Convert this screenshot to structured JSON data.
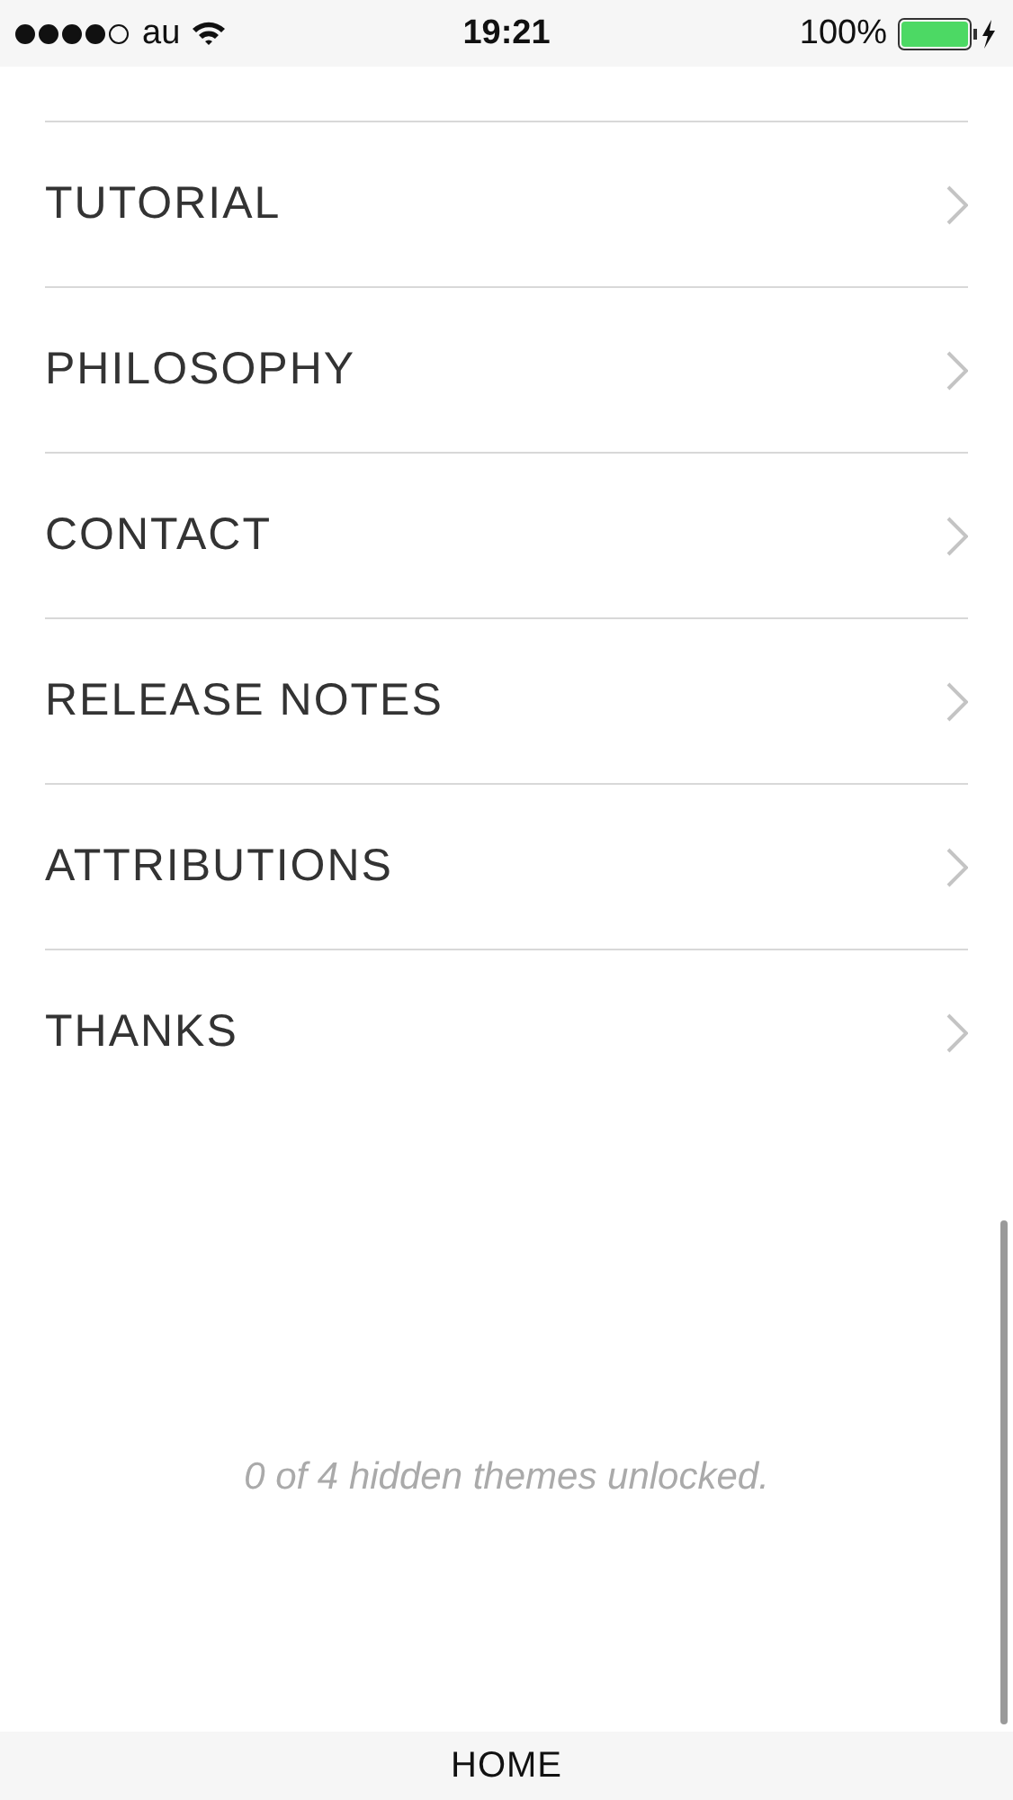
{
  "status_bar": {
    "carrier": "au",
    "time": "19:21",
    "battery": "100%"
  },
  "menu_items": [
    {
      "label": "TUTORIAL"
    },
    {
      "label": "PHILOSOPHY"
    },
    {
      "label": "CONTACT"
    },
    {
      "label": "RELEASE NOTES"
    },
    {
      "label": "ATTRIBUTIONS"
    },
    {
      "label": "THANKS"
    }
  ],
  "unlock_message": "0 of 4 hidden themes unlocked.",
  "bottom_bar": {
    "label": "HOME"
  }
}
